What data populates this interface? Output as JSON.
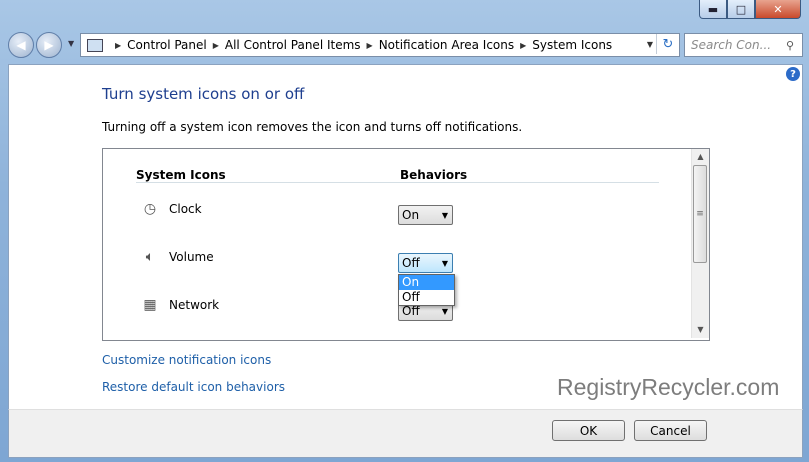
{
  "window": {
    "minimize_glyph": "▬",
    "maximize_glyph": "□",
    "close_glyph": "✕"
  },
  "nav": {
    "back_icon": "arrow-left-icon",
    "forward_icon": "arrow-right-icon"
  },
  "address": {
    "crumbs": [
      "Control Panel",
      "All Control Panel Items",
      "Notification Area Icons",
      "System Icons"
    ]
  },
  "search": {
    "placeholder": "Search Con..."
  },
  "page": {
    "help_label": "?",
    "heading": "Turn system icons on or off",
    "description": "Turning off a system icon removes the icon and turns off notifications.",
    "columns": {
      "icons": "System Icons",
      "behaviors": "Behaviors"
    },
    "rows": [
      {
        "label": "Clock",
        "icon": "clock-icon",
        "value": "On"
      },
      {
        "label": "Volume",
        "icon": "speaker-icon",
        "value": "Off"
      },
      {
        "label": "Network",
        "icon": "network-icon",
        "value": "Off"
      }
    ],
    "dropdown_options": [
      "On",
      "Off"
    ],
    "dropdown_selected": "On",
    "links": {
      "customize": "Customize notification icons",
      "restore": "Restore default icon behaviors"
    }
  },
  "watermark": "RegistryRecycler.com",
  "footer": {
    "ok": "OK",
    "cancel": "Cancel"
  }
}
